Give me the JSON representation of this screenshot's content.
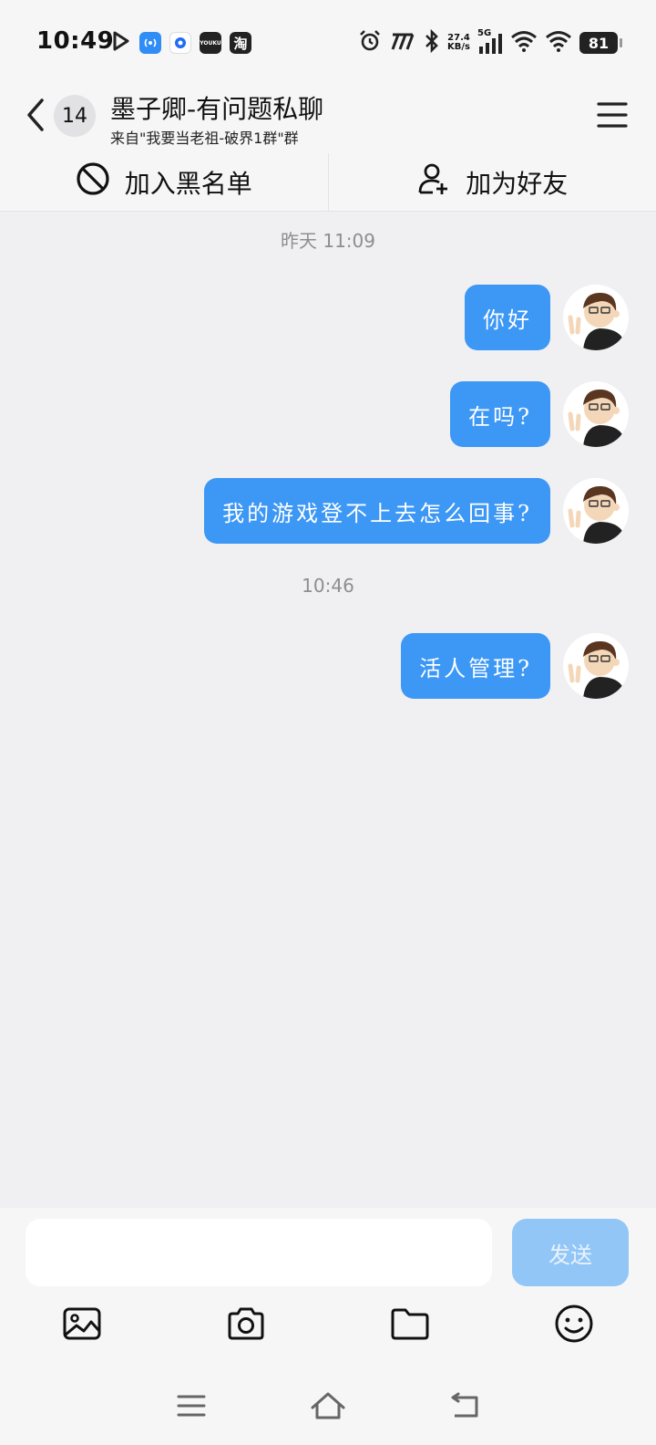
{
  "status_bar": {
    "time": "10:49",
    "net_speed": "27.4",
    "net_unit": "KB/s",
    "network": "5G",
    "battery": "81",
    "apps": [
      "play-icon",
      "hotspot-app-icon",
      "browser-app-icon",
      "youku-app-icon",
      "taobao-app-icon"
    ],
    "youku_label": "YOUKU",
    "taobao_label": "淘"
  },
  "header": {
    "unread_count": "14",
    "title": "墨子卿-有问题私聊",
    "subtitle": "来自\"我要当老祖-破界1群\"群"
  },
  "actions": {
    "blacklist_label": "加入黑名单",
    "add_friend_label": "加为好友"
  },
  "chat": {
    "timestamps": [
      "昨天 11:09",
      "10:46"
    ],
    "messages": [
      {
        "text": "你好"
      },
      {
        "text": "在吗?"
      },
      {
        "text": "我的游戏登不上去怎么回事?"
      },
      {
        "text": "活人管理?"
      }
    ]
  },
  "input": {
    "value": "",
    "placeholder": "",
    "send_label": "发送"
  },
  "colors": {
    "bubble": "#3c97f5",
    "send_disabled": "#92c6f6",
    "background": "#f0f0f3"
  }
}
